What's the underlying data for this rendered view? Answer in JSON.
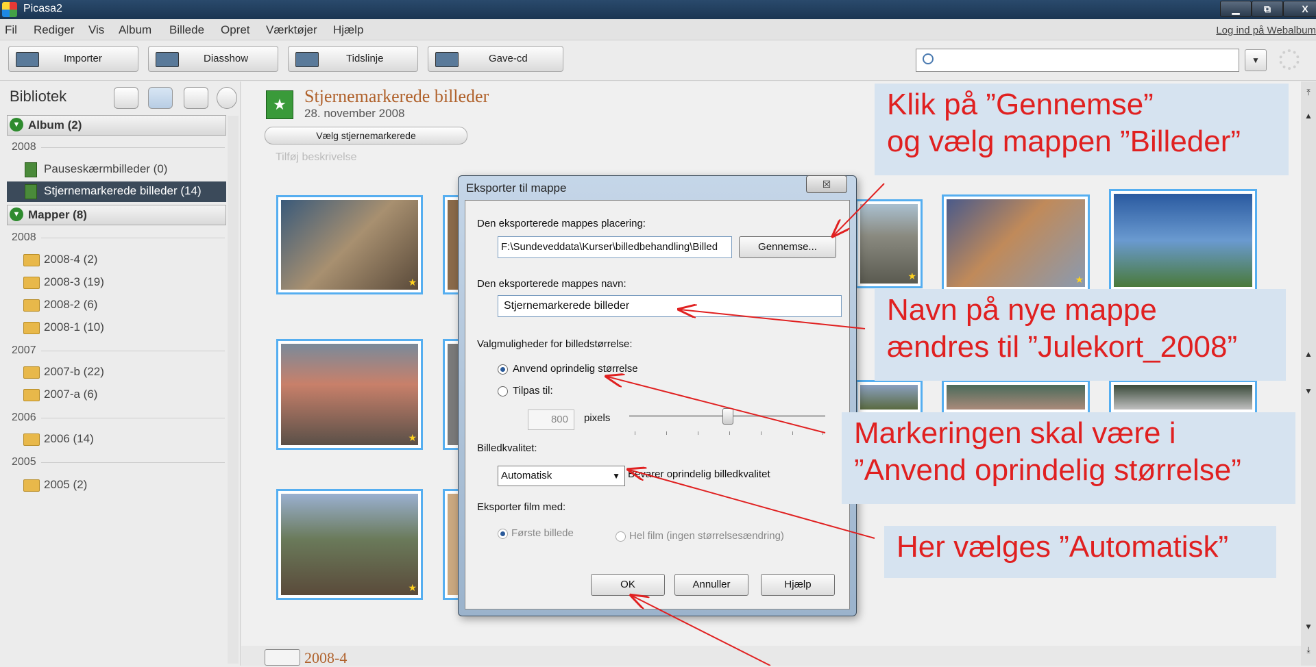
{
  "window": {
    "title": "Picasa2",
    "minimize": "▁",
    "restore": "⧉",
    "close": "X"
  },
  "menu": {
    "items": [
      "Fil",
      "Rediger",
      "Vis",
      "Album",
      "Billede",
      "Opret",
      "Værktøjer",
      "Hjælp"
    ],
    "web_login": "Log ind på Webalbum"
  },
  "toolbar": {
    "import": "Importer",
    "slideshow": "Diasshow",
    "timeline": "Tidslinje",
    "gift_cd": "Gave-cd",
    "search_value": "",
    "search_dropdown": "▼"
  },
  "library": {
    "title": "Bibliotek",
    "albums_group": "Album (2)",
    "albums": [
      {
        "year": "2008",
        "items": [
          {
            "label": "Pauseskærmbilleder (0)",
            "selected": false
          },
          {
            "label": "Stjernemarkerede billeder (14)",
            "selected": true
          }
        ]
      }
    ],
    "folders_group": "Mapper (8)",
    "folders": [
      {
        "year": "2008",
        "items": [
          "2008-4 (2)",
          "2008-3 (19)",
          "2008-2 (6)",
          "2008-1 (10)"
        ]
      },
      {
        "year": "2007",
        "items": [
          "2007-b (22)",
          "2007-a (6)"
        ]
      },
      {
        "year": "2006",
        "items": [
          "2006 (14)"
        ]
      },
      {
        "year": "2005",
        "items": [
          "2005 (2)"
        ]
      }
    ]
  },
  "album": {
    "icon_glyph": "★",
    "title": "Stjernemarkerede billeder",
    "date": "28. november 2008",
    "select_starred": "Vælg stjernemarkerede",
    "add_description": "Tilføj beskrivelse",
    "footer_folder": "2008-4",
    "star_glyph": "★"
  },
  "dialog": {
    "title": "Eksporter til mappe",
    "close": "☒",
    "location_label": "Den eksporterede mappes placering:",
    "location_value": "F:\\Sundeveddata\\Kurser\\billedbehandling\\Billed",
    "browse": "Gennemse...",
    "name_label": "Den eksporterede mappes navn:",
    "name_value": "Stjernemarkerede billeder",
    "size_label": "Valgmuligheder for billedstørrelse:",
    "size_original": "Anvend oprindelig størrelse",
    "size_resize": "Tilpas til:",
    "resize_value": "800",
    "pixels": "pixels",
    "quality_label": "Billedkvalitet:",
    "quality_value": "Automatisk",
    "quality_hint": "Bevarer oprindelig billedkvalitet",
    "film_label": "Eksporter film med:",
    "film_first": "Første billede",
    "film_whole": "Hel film (ingen størrelsesændring)",
    "ok": "OK",
    "cancel": "Annuller",
    "help": "Hjælp"
  },
  "annotations": {
    "browse_line1": "Klik på ”Gennemse”",
    "browse_line2": "og vælg mappen ”Billeder”",
    "name_line1": "Navn på nye mappe",
    "name_line2": "ændres til ”Julekort_2008”",
    "size_line1": "Markeringen skal være i",
    "size_line2": "”Anvend oprindelig størrelse”",
    "quality_line1": "Her vælges ”Automatisk”",
    "color": "#e02020"
  }
}
